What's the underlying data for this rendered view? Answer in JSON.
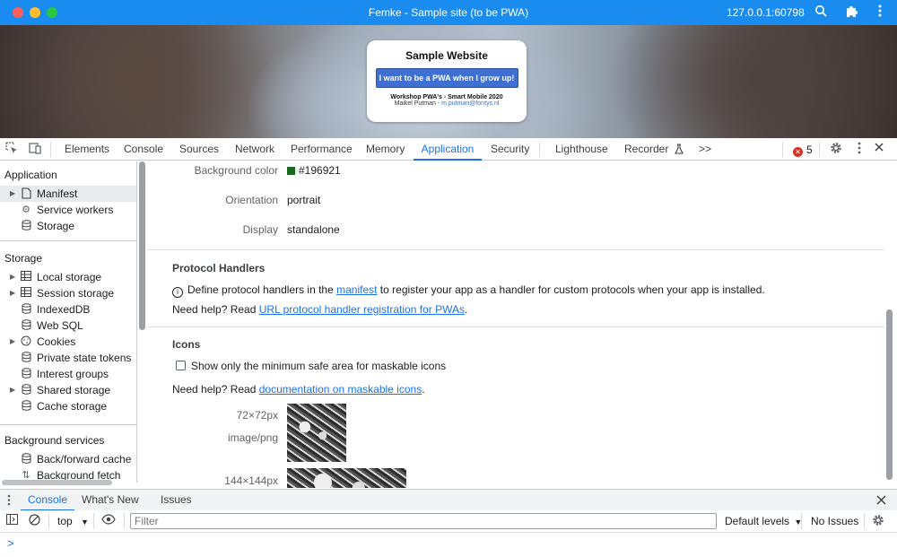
{
  "window": {
    "title": "Femke - Sample site (to be PWA)",
    "host": "127.0.0.1:60798"
  },
  "page": {
    "card_title": "Sample Website",
    "card_button": "I want to be a PWA when I grow up!",
    "card_line1": "Workshop PWA's - Smart Mobile 2020",
    "card_line2_name": "Maikel Putman - ",
    "card_line2_email": "m.putman@fontys.nl"
  },
  "devtools": {
    "tabs": [
      "Elements",
      "Console",
      "Sources",
      "Network",
      "Performance",
      "Memory",
      "Application",
      "Security",
      "Lighthouse",
      "Recorder"
    ],
    "active_tab": "Application",
    "more": ">>",
    "error_count": "5"
  },
  "sidebar": {
    "application_title": "Application",
    "application_items": [
      {
        "label": "Manifest",
        "icon": "file-icon"
      },
      {
        "label": "Service workers",
        "icon": "gears-icon"
      },
      {
        "label": "Storage",
        "icon": "database-icon"
      }
    ],
    "storage_title": "Storage",
    "storage_items": [
      {
        "label": "Local storage",
        "icon": "table-icon"
      },
      {
        "label": "Session storage",
        "icon": "table-icon"
      },
      {
        "label": "IndexedDB",
        "icon": "database-icon"
      },
      {
        "label": "Web SQL",
        "icon": "database-icon"
      },
      {
        "label": "Cookies",
        "icon": "cookie-icon"
      },
      {
        "label": "Private state tokens",
        "icon": "database-icon"
      },
      {
        "label": "Interest groups",
        "icon": "database-icon"
      },
      {
        "label": "Shared storage",
        "icon": "database-icon"
      },
      {
        "label": "Cache storage",
        "icon": "database-icon"
      }
    ],
    "bg_title": "Background services",
    "bg_items": [
      {
        "label": "Back/forward cache",
        "icon": "database-icon"
      },
      {
        "label": "Background fetch",
        "icon": "arrows-icon"
      }
    ]
  },
  "manifest": {
    "background_color_key": "Background color",
    "background_color_value": "#196921",
    "orientation_key": "Orientation",
    "orientation_value": "portrait",
    "display_key": "Display",
    "display_value": "standalone"
  },
  "protocol": {
    "title": "Protocol Handlers",
    "text_before": "Define protocol handlers in the ",
    "link": "manifest",
    "text_after": " to register your app as a handler for custom protocols when your app is installed.",
    "help_prefix": "Need help? Read ",
    "help_link": "URL protocol handler registration for PWAs",
    "help_suffix": "."
  },
  "icons": {
    "title": "Icons",
    "checkbox_label": "Show only the minimum safe area for maskable icons",
    "checkbox_checked": false,
    "help_prefix": "Need help? Read ",
    "help_link": "documentation on maskable icons",
    "help_suffix": ".",
    "icon1_size": "72×72px",
    "icon1_type": "image/png",
    "icon2_size": "144×144px"
  },
  "drawer": {
    "tabs": [
      "Console",
      "What's New",
      "Issues"
    ],
    "active_tab": "Console",
    "context": "top",
    "filter_placeholder": "Filter",
    "levels": "Default levels",
    "issues": "No Issues",
    "prompt": ">"
  }
}
